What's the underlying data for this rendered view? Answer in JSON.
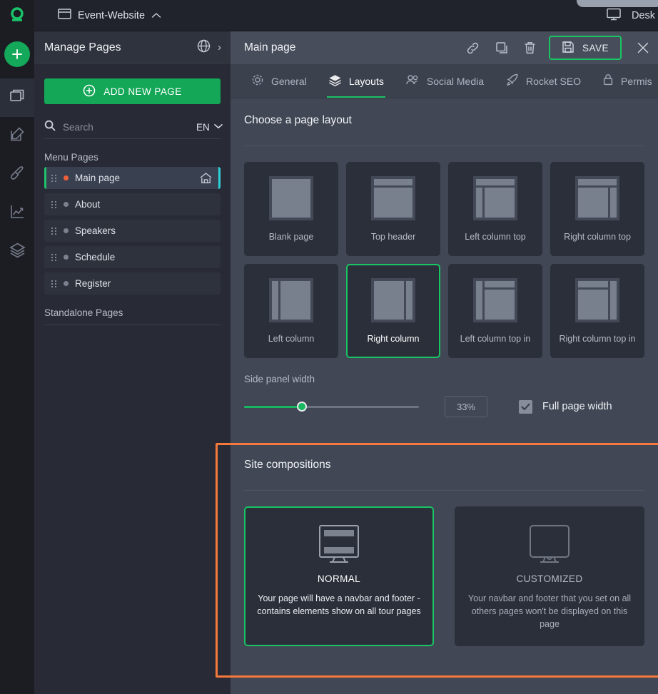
{
  "topbar": {
    "site_name": "Event-Website",
    "site_icon": "window-icon",
    "collapse_icon": "chevron-up-icon",
    "device_label": "Desk",
    "device_icon": "desktop-icon"
  },
  "rail": {
    "logo": "app-logo",
    "add_label": "+",
    "items": [
      {
        "name": "pages-icon",
        "active": true
      },
      {
        "name": "edit-icon",
        "active": false
      },
      {
        "name": "brush-icon",
        "active": false
      },
      {
        "name": "analytics-icon",
        "active": false
      },
      {
        "name": "layers-icon",
        "active": false
      }
    ]
  },
  "sidebar": {
    "title": "Manage Pages",
    "globe_icon": "globe-icon",
    "expand_icon": "chevron-right-icon",
    "add_page_label": "ADD NEW PAGE",
    "search_placeholder": "Search",
    "search_value": "",
    "language": "EN",
    "menu_group_label": "Menu Pages",
    "standalone_group_label": "Standalone Pages",
    "pages": [
      {
        "label": "Main page",
        "status": "orange",
        "active": true,
        "home": true
      },
      {
        "label": "About",
        "status": "grey",
        "active": false,
        "home": false
      },
      {
        "label": "Speakers",
        "status": "grey",
        "active": false,
        "home": false
      },
      {
        "label": "Schedule",
        "status": "grey",
        "active": false,
        "home": false
      },
      {
        "label": "Register",
        "status": "grey",
        "active": false,
        "home": false
      }
    ]
  },
  "main": {
    "title": "Main page",
    "tools": [
      {
        "name": "link-icon"
      },
      {
        "name": "copy-icon"
      },
      {
        "name": "trash-icon"
      }
    ],
    "save_label": "SAVE",
    "close_icon": "close-icon",
    "tabs": [
      {
        "label": "General",
        "icon": "gear-icon",
        "active": false
      },
      {
        "label": "Layouts",
        "icon": "layers-icon",
        "active": true
      },
      {
        "label": "Social Media",
        "icon": "people-icon",
        "active": false
      },
      {
        "label": "Rocket SEO",
        "icon": "rocket-icon",
        "active": false
      },
      {
        "label": "Permis",
        "icon": "lock-icon",
        "active": false
      }
    ],
    "layout_section_title": "Choose a page layout",
    "layouts": [
      {
        "label": "Blank page",
        "selected": false,
        "kind": "blank"
      },
      {
        "label": "Top header",
        "selected": false,
        "kind": "top"
      },
      {
        "label": "Left column top",
        "selected": false,
        "kind": "left-top"
      },
      {
        "label": "Right column top",
        "selected": false,
        "kind": "right-top"
      },
      {
        "label": "Left column",
        "selected": false,
        "kind": "left"
      },
      {
        "label": "Right column",
        "selected": true,
        "kind": "right"
      },
      {
        "label": "Left column top in",
        "selected": false,
        "kind": "left-top-in"
      },
      {
        "label": "Right column top in",
        "selected": false,
        "kind": "right-top-in"
      }
    ],
    "side_panel_width_label": "Side panel width",
    "side_panel_width_value": "33%",
    "side_panel_width_percent": 33,
    "full_page_width_label": "Full page width",
    "full_page_width_checked": true,
    "compositions_title": "Site compositions",
    "compositions": [
      {
        "name": "NORMAL",
        "description": "Your page will have a navbar and footer - contains elements show on all tour pages",
        "selected": true,
        "icon": "monitor-with-bars-icon"
      },
      {
        "name": "CUSTOMIZED",
        "description": "Your navbar and footer that you set on all others pages won't be displayed on this page",
        "selected": false,
        "icon": "monitor-plain-icon"
      }
    ]
  },
  "colors": {
    "accent_green": "#19c464",
    "highlight_orange": "#f5793b",
    "status_orange": "#f0603a",
    "cyan_edge": "#2fd1d9"
  }
}
